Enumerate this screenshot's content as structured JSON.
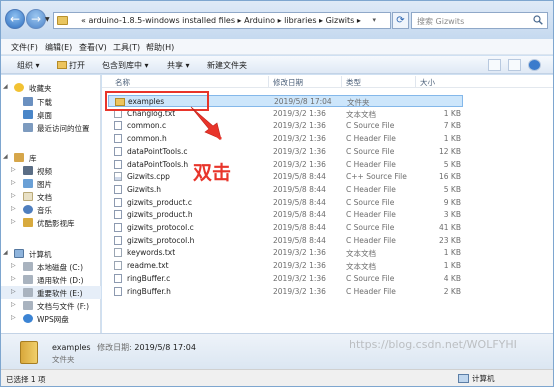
{
  "address": {
    "path": "«  arduino-1.8.5-windows installed files  ▸  Arduino  ▸  libraries  ▸  Gizwits  ▸",
    "search_placeholder": "搜索 Gizwits"
  },
  "menu": [
    "文件(F)",
    "编辑(E)",
    "查看(V)",
    "工具(T)",
    "帮助(H)"
  ],
  "toolbar": {
    "organize": "组织 ▾",
    "open": "打开",
    "include_in_library": "包含到库中 ▾",
    "share": "共享 ▾",
    "new_folder": "新建文件夹"
  },
  "nav": {
    "favorites": "收藏夹",
    "downloads": "下载",
    "desktop": "桌面",
    "recent": "最近访问的位置",
    "libraries": "库",
    "videos": "视频",
    "pictures": "图片",
    "documents": "文档",
    "music": "音乐",
    "youku": "优酷影视库",
    "computer": "计算机",
    "drive_c": "本地磁盘 (C:)",
    "drive_d": "通用软件 (D:)",
    "drive_e": "重要软件 (E:)",
    "drive_f": "文档与文件 (F:)",
    "wps": "WPS网盘"
  },
  "columns": {
    "name": "名称",
    "date": "修改日期",
    "type": "类型",
    "size": "大小"
  },
  "files": [
    {
      "name": "examples",
      "date": "2019/5/8 17:04",
      "type": "文件夹",
      "size": "",
      "icon": "folder"
    },
    {
      "name": "Changlog.txt",
      "date": "2019/3/2 1:36",
      "type": "文本文档",
      "size": "1 KB",
      "icon": "text"
    },
    {
      "name": "common.c",
      "date": "2019/3/2 1:36",
      "type": "C Source File",
      "size": "7 KB",
      "icon": "c"
    },
    {
      "name": "common.h",
      "date": "2019/3/2 1:36",
      "type": "C Header File",
      "size": "1 KB",
      "icon": "c"
    },
    {
      "name": "dataPointTools.c",
      "date": "2019/3/2 1:36",
      "type": "C Source File",
      "size": "12 KB",
      "icon": "c"
    },
    {
      "name": "dataPointTools.h",
      "date": "2019/3/2 1:36",
      "type": "C Header File",
      "size": "5 KB",
      "icon": "c"
    },
    {
      "name": "Gizwits.cpp",
      "date": "2019/5/8 8:44",
      "type": "C++ Source File",
      "size": "16 KB",
      "icon": "code"
    },
    {
      "name": "Gizwits.h",
      "date": "2019/5/8 8:44",
      "type": "C Header File",
      "size": "5 KB",
      "icon": "c"
    },
    {
      "name": "gizwits_product.c",
      "date": "2019/5/8 8:44",
      "type": "C Source File",
      "size": "9 KB",
      "icon": "c"
    },
    {
      "name": "gizwits_product.h",
      "date": "2019/5/8 8:44",
      "type": "C Header File",
      "size": "3 KB",
      "icon": "c"
    },
    {
      "name": "gizwits_protocol.c",
      "date": "2019/5/8 8:44",
      "type": "C Source File",
      "size": "41 KB",
      "icon": "c"
    },
    {
      "name": "gizwits_protocol.h",
      "date": "2019/5/8 8:44",
      "type": "C Header File",
      "size": "23 KB",
      "icon": "c"
    },
    {
      "name": "keywords.txt",
      "date": "2019/3/2 1:36",
      "type": "文本文档",
      "size": "1 KB",
      "icon": "text"
    },
    {
      "name": "readme.txt",
      "date": "2019/3/2 1:36",
      "type": "文本文档",
      "size": "1 KB",
      "icon": "text"
    },
    {
      "name": "ringBuffer.c",
      "date": "2019/3/2 1:36",
      "type": "C Source File",
      "size": "4 KB",
      "icon": "c"
    },
    {
      "name": "ringBuffer.h",
      "date": "2019/3/2 1:36",
      "type": "C Header File",
      "size": "2 KB",
      "icon": "c"
    }
  ],
  "annotation": "双击",
  "details": {
    "name": "examples",
    "meta_label": "修改日期:",
    "meta_value": "2019/5/8 17:04",
    "type": "文件夹"
  },
  "status": {
    "count": "已选择 1 项",
    "location": "计算机"
  },
  "watermark": "https://blog.csdn.net/WOLFYHI",
  "colors": {
    "selection": "#cde6fb",
    "annotation": "#e8352b",
    "folder": "#ecc45e"
  }
}
